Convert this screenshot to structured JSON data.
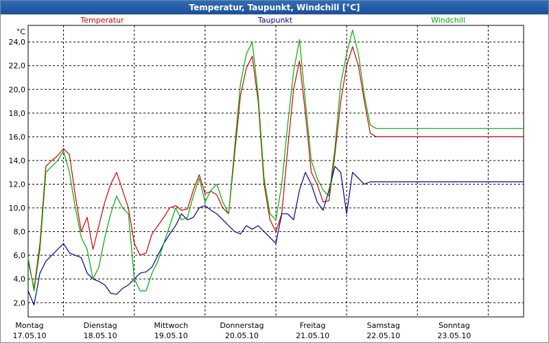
{
  "window": {
    "title": "Temperatur, Taupunkt, Windchill [°C]"
  },
  "chart_data": {
    "type": "line",
    "title": "Temperatur, Taupunkt, Windchill [°C]",
    "ylabel": "°C",
    "ylim": [
      0.8,
      25.4
    ],
    "xlim": [
      0,
      168
    ],
    "grid": true,
    "legend": "top",
    "y_ticks": [
      2.0,
      4.0,
      6.0,
      8.0,
      10.0,
      12.0,
      14.0,
      16.0,
      18.0,
      20.0,
      22.0,
      24.0
    ],
    "y_tick_labels": [
      "2,0",
      "4,0",
      "6,0",
      "8,0",
      "10,0",
      "12,0",
      "14,0",
      "16,0",
      "18,0",
      "20,0",
      "22,0",
      "24,0"
    ],
    "x_ticks": [
      {
        "h": 0,
        "day": "Montag",
        "date": "17.05.10"
      },
      {
        "h": 24,
        "day": "Dienstag",
        "date": "18.05.10"
      },
      {
        "h": 48,
        "day": "Mittwoch",
        "date": "19.05.10"
      },
      {
        "h": 72,
        "day": "Donnerstag",
        "date": "20.05.10"
      },
      {
        "h": 96,
        "day": "Freitag",
        "date": "21.05.10"
      },
      {
        "h": 120,
        "day": "Samstag",
        "date": "22.05.10"
      },
      {
        "h": 144,
        "day": "Sonntag",
        "date": "23.05.10"
      }
    ],
    "x": [
      0,
      2,
      4,
      6,
      8,
      10,
      12,
      14,
      16,
      18,
      20,
      22,
      24,
      26,
      28,
      30,
      32,
      34,
      36,
      38,
      40,
      42,
      44,
      46,
      48,
      50,
      52,
      54,
      56,
      58,
      60,
      62,
      64,
      66,
      68,
      70,
      72,
      74,
      76,
      78,
      80,
      82,
      84,
      86,
      88,
      90,
      92,
      94,
      96,
      98,
      100,
      102,
      104,
      106,
      108,
      110,
      112,
      114,
      116,
      118,
      120,
      122,
      124,
      126,
      128,
      130,
      132,
      134,
      136,
      138,
      140,
      142,
      144,
      146,
      148,
      150,
      152,
      154,
      156,
      158,
      160,
      162,
      164,
      166,
      168
    ],
    "series": [
      {
        "name": "Temperatur",
        "color": "#cc0000",
        "values": [
          5.5,
          3.2,
          7.0,
          13.5,
          14.0,
          14.4,
          15.0,
          14.5,
          11.0,
          8.0,
          9.2,
          6.5,
          8.5,
          10.5,
          12.0,
          13.0,
          11.5,
          10.0,
          7.0,
          6.0,
          6.2,
          7.8,
          8.5,
          9.2,
          10.0,
          10.2,
          9.8,
          9.9,
          11.5,
          12.8,
          11.2,
          11.4,
          11.1,
          10.0,
          9.5,
          14.5,
          19.5,
          21.8,
          22.8,
          19.0,
          12.0,
          9.0,
          8.0,
          9.5,
          15.0,
          20.0,
          22.4,
          18.0,
          13.0,
          12.0,
          10.5,
          10.6,
          14.5,
          19.0,
          22.0,
          23.6,
          22.0,
          19.0,
          16.3,
          16.0,
          16.0,
          16.0,
          16.0,
          16.0,
          16.0,
          16.0,
          16.0,
          16.0,
          16.0,
          16.0,
          16.0,
          16.0,
          16.0,
          16.0,
          16.0,
          16.0,
          16.0,
          16.0,
          16.0,
          16.0,
          16.0,
          16.0,
          16.0,
          16.0,
          16.0
        ]
      },
      {
        "name": "Taupunkt",
        "color": "#00008b",
        "values": [
          3.0,
          1.8,
          4.5,
          5.5,
          6.0,
          6.5,
          7.0,
          6.2,
          6.0,
          5.8,
          4.5,
          4.0,
          3.8,
          3.5,
          2.8,
          2.7,
          3.2,
          3.5,
          4.0,
          4.5,
          4.6,
          5.0,
          6.0,
          7.0,
          7.8,
          8.5,
          9.5,
          9.0,
          9.2,
          10.0,
          10.2,
          9.8,
          9.5,
          9.0,
          8.5,
          8.0,
          7.8,
          8.5,
          8.2,
          8.5,
          8.0,
          7.5,
          7.0,
          9.5,
          9.5,
          9.0,
          11.5,
          13.0,
          12.0,
          10.5,
          9.8,
          11.5,
          13.5,
          13.0,
          9.5,
          13.0,
          12.5,
          12.0,
          12.2,
          12.2,
          12.2,
          12.2,
          12.2,
          12.2,
          12.2,
          12.2,
          12.2,
          12.2,
          12.2,
          12.2,
          12.2,
          12.2,
          12.2,
          12.2,
          12.2,
          12.2,
          12.2,
          12.2,
          12.2,
          12.2,
          12.2,
          12.2,
          12.2,
          12.2,
          12.2
        ]
      },
      {
        "name": "Windchill",
        "color": "#00aa00",
        "values": [
          5.8,
          3.0,
          6.5,
          13.0,
          13.5,
          14.0,
          14.8,
          13.0,
          10.0,
          7.5,
          6.5,
          4.0,
          5.0,
          7.5,
          9.5,
          11.0,
          10.0,
          9.5,
          4.0,
          3.0,
          3.0,
          4.5,
          5.5,
          7.0,
          8.5,
          10.0,
          9.0,
          9.2,
          11.0,
          12.5,
          10.5,
          11.5,
          12.0,
          10.5,
          9.5,
          15.0,
          20.5,
          23.0,
          24.0,
          19.5,
          12.5,
          9.5,
          9.0,
          12.0,
          17.0,
          21.5,
          24.2,
          19.0,
          14.0,
          12.5,
          11.5,
          11.0,
          15.0,
          20.5,
          23.0,
          25.0,
          23.0,
          19.5,
          17.0,
          16.7,
          16.7,
          16.7,
          16.7,
          16.7,
          16.7,
          16.7,
          16.7,
          16.7,
          16.7,
          16.7,
          16.7,
          16.7,
          16.7,
          16.7,
          16.7,
          16.7,
          16.7,
          16.7,
          16.7,
          16.7,
          16.7,
          16.7,
          16.7,
          16.7,
          16.7
        ]
      }
    ]
  }
}
